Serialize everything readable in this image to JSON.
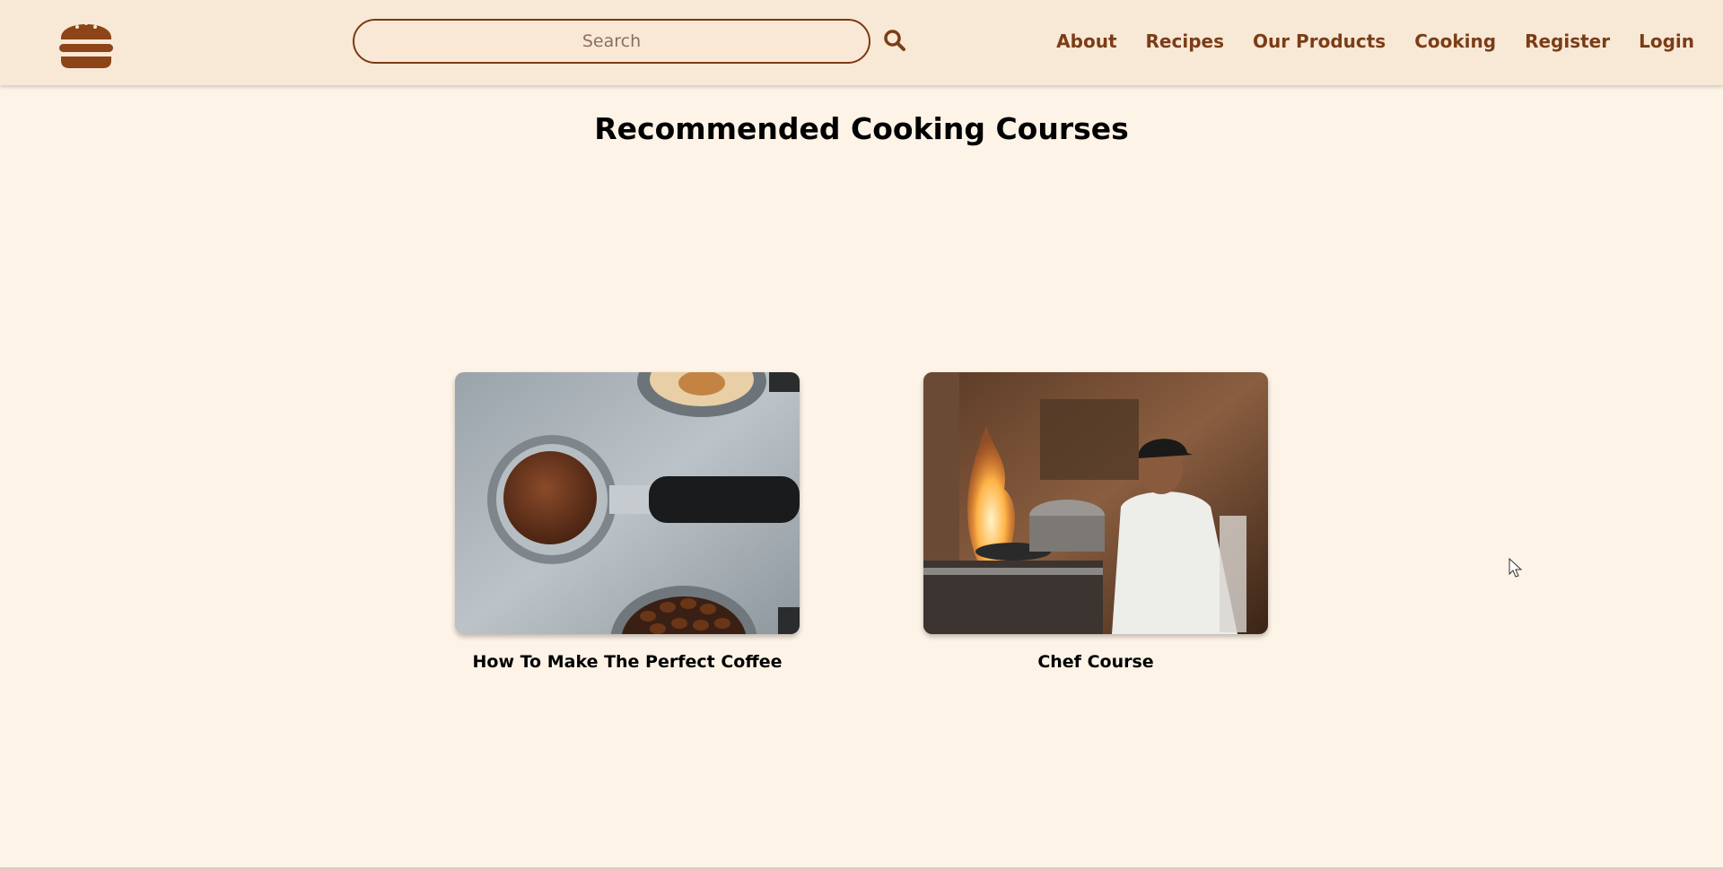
{
  "header": {
    "logo_icon": "burger-icon",
    "search": {
      "placeholder": "Search",
      "value": "",
      "icon": "search-icon"
    },
    "nav": [
      "About",
      "Recipes",
      "Our Products",
      "Cooking",
      "Register",
      "Login"
    ]
  },
  "main": {
    "title": "Recommended Cooking Courses",
    "courses": [
      {
        "title": "How To Make The Perfect Coffee",
        "image": "coffee-portafilter-photo"
      },
      {
        "title": "Chef Course",
        "image": "chef-flambe-photo"
      }
    ]
  },
  "colors": {
    "background": "#fdf3e7",
    "header": "#f8e8d6",
    "accent": "#7a3d17"
  }
}
